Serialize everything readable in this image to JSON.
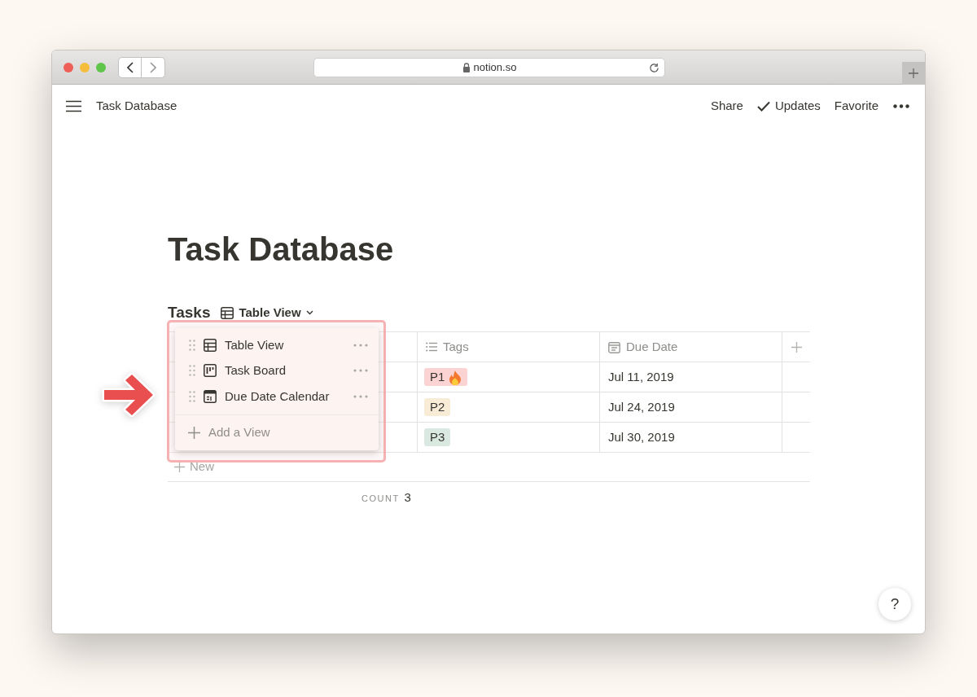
{
  "browser": {
    "address": "notion.so"
  },
  "topbar": {
    "title": "Task Database",
    "actions": [
      {
        "label": "Share",
        "checked": false
      },
      {
        "label": "Updates",
        "checked": true
      },
      {
        "label": "Favorite",
        "checked": false
      }
    ]
  },
  "page": {
    "title": "Task Database"
  },
  "database": {
    "name": "Tasks",
    "current_view": "Table View"
  },
  "table": {
    "columns": [
      {
        "label": "Tags",
        "kind": "multi"
      },
      {
        "label": "Due Date",
        "kind": "date"
      }
    ],
    "rows": [
      {
        "tag": {
          "label": "P1",
          "color": "#fbd3d2",
          "hot": true
        },
        "due": "Jul 11, 2019"
      },
      {
        "tag": {
          "label": "P2",
          "color": "#f9ecd7",
          "hot": false
        },
        "due": "Jul 24, 2019"
      },
      {
        "tag": {
          "label": "P3",
          "color": "#d9e9e2",
          "hot": false
        },
        "due": "Jul 30, 2019"
      }
    ],
    "new_label": "New",
    "count_label": "COUNT",
    "count": "3"
  },
  "view_menu": {
    "views": [
      {
        "label": "Table View",
        "kind": "table"
      },
      {
        "label": "Task Board",
        "kind": "board"
      },
      {
        "label": "Due Date Calendar",
        "kind": "calendar"
      }
    ],
    "add_label": "Add a View"
  },
  "help": "?"
}
